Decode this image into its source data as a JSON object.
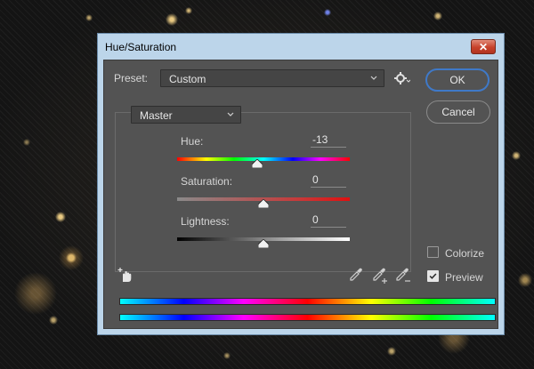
{
  "window": {
    "title": "Hue/Saturation"
  },
  "preset": {
    "label": "Preset:",
    "value": "Custom"
  },
  "buttons": {
    "ok": "OK",
    "cancel": "Cancel"
  },
  "channel": {
    "value": "Master"
  },
  "sliders": {
    "hue": {
      "label": "Hue:",
      "value": "-13",
      "min": -180,
      "max": 180
    },
    "saturation": {
      "label": "Saturation:",
      "value": "0",
      "min": -100,
      "max": 100
    },
    "lightness": {
      "label": "Lightness:",
      "value": "0",
      "min": -100,
      "max": 100
    }
  },
  "options": {
    "colorize": {
      "label": "Colorize",
      "checked": false
    },
    "preview": {
      "label": "Preview",
      "checked": true
    }
  },
  "colors": {
    "dialog_bg": "#535353",
    "ok_border": "#3f79c8",
    "titlebar": "#bcd5ea",
    "close": "#c7422b"
  },
  "icons": [
    "close-icon",
    "chevron-down-icon",
    "gear-icon",
    "hand-target-icon",
    "eyedropper-icon",
    "eyedropper-plus-icon",
    "eyedropper-minus-icon",
    "checkmark-icon"
  ]
}
